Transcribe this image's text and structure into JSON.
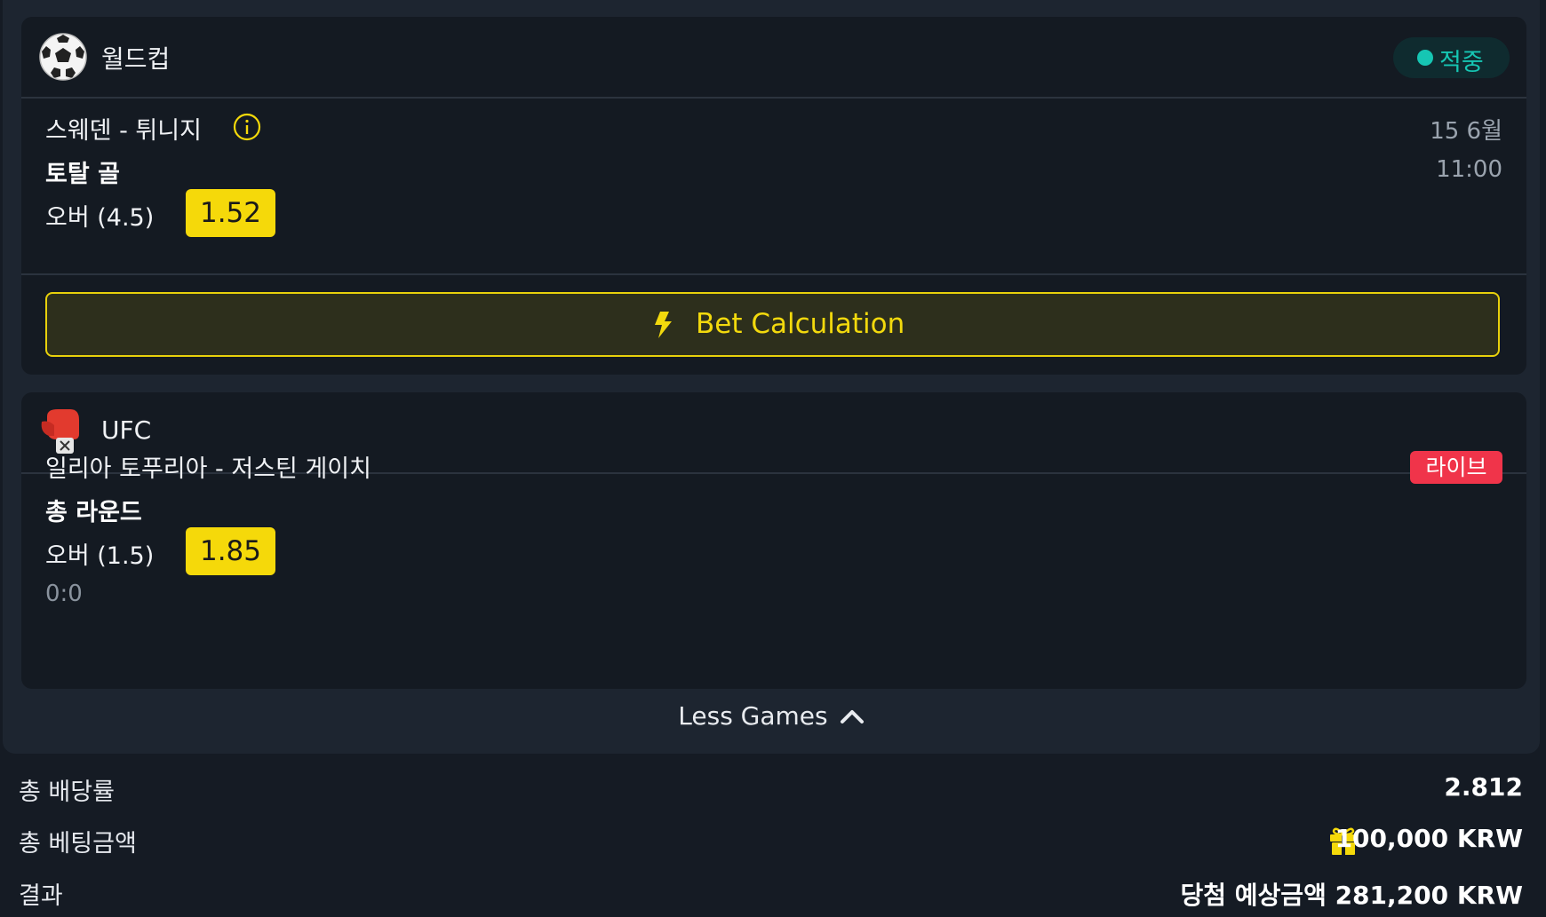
{
  "bets": [
    {
      "sport": "월드컵",
      "sport_icon": "soccer-ball-icon",
      "status": "적중",
      "status_color": "#16c6b3",
      "match": "스웨덴 - 튀니지",
      "date": "15 6월",
      "time": "11:00",
      "market": "토탈 골",
      "pick": "오버 (4.5)",
      "odds": "1.52"
    },
    {
      "sport": "UFC",
      "sport_icon": "boxing-glove-icon",
      "badge": "라이브",
      "badge_color": "#f0344a",
      "match": "일리아 토푸리아 - 저스틴 게이치",
      "market": "총 라운드",
      "pick": "오버 (1.5)",
      "odds": "1.85",
      "score": "0:0"
    }
  ],
  "calc_button": "Bet Calculation",
  "less_games": "Less Games",
  "summary": {
    "total_odds_label": "총 배당률",
    "total_odds_value": "2.812",
    "total_stake_label": "총 베팅금액",
    "total_stake_value": "100,000 KRW",
    "result_label": "결과",
    "result_value": "당첨 예상금액 281,200 KRW"
  },
  "colors": {
    "accent_yellow": "#f5d90a",
    "background": "#151b24"
  }
}
